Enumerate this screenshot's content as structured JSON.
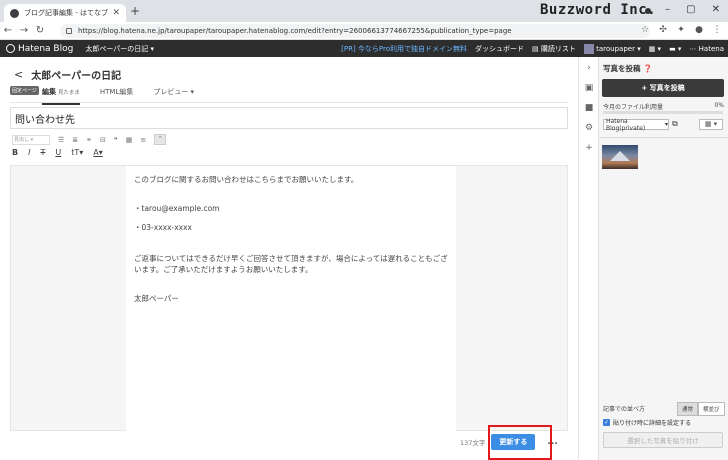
{
  "browser": {
    "tab_title": "ブログ記事編集 - はてなブログ",
    "new_tab": "+",
    "brand_overlay": "Buzzword Inc.",
    "url": "https://blog.hatena.ne.jp/taroupaper/taroupaper.hatenablog.com/edit?entry=26006613774667255&publication_type=page"
  },
  "header": {
    "logo": "Hatena Blog",
    "blog_menu": "太郎ペーパーの日記 ▾",
    "promo": "[PR] 今ならPro利用で独自ドメイン無料",
    "dashboard": "ダッシュボード",
    "reading_list": "購読リスト",
    "user": "taroupaper ▾",
    "brand": "Hatena"
  },
  "editor": {
    "back": "<",
    "blog_title": "太郎ペーパーの日記",
    "fixed_page_badge": "固定ページ",
    "tabs": [
      {
        "label": "編集",
        "sub": "見たまま"
      },
      {
        "label": "HTML編集"
      },
      {
        "label": "プレビュー ▾"
      }
    ],
    "title_value": "問い合わせ先",
    "heading_select": "見出し",
    "content": [
      "このブログに関するお問い合わせはこちらまでお願いいたします。",
      "・tarou@example.com",
      "・03-xxxx-xxxx",
      "ご返事についてはできるだけ早くご回答させて頂きますが、場合によっては遅れることもございます。ご了承いただけますようお願いいたします。",
      "太郎ペーパー"
    ],
    "char_count": "137文字",
    "update_button": "更新する",
    "more": "..."
  },
  "panel": {
    "title": "写真を投稿",
    "upload_button": "+ 写真を投稿",
    "usage_label": "今月のファイル利用量",
    "usage_pct": "0%",
    "album_select": "Hatena Blog(private)",
    "sort_label": "記事での並べ方",
    "sort_options": [
      "通常",
      "横並び"
    ],
    "checkbox_label": "貼り付け時に詳細を設定する",
    "paste_button": "選択した写真を貼り付け"
  }
}
